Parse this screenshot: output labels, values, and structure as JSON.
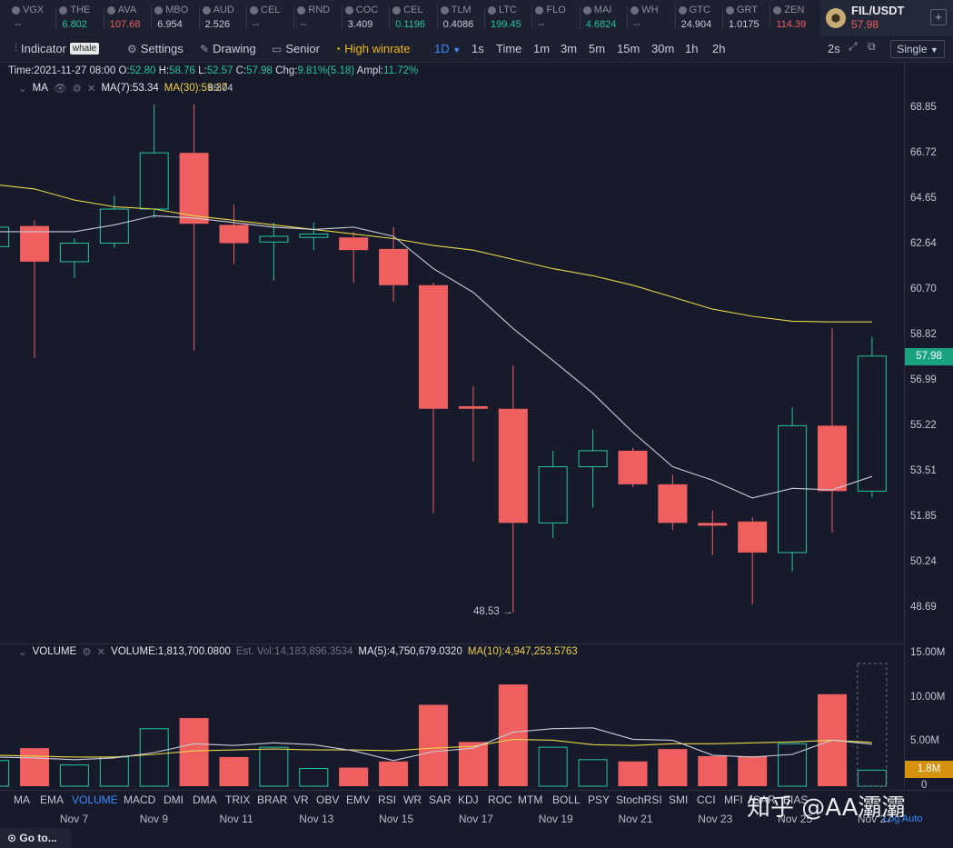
{
  "tickers": [
    {
      "name": "VGX",
      "price": "--",
      "color": "#8b90a0"
    },
    {
      "name": "THE",
      "price": "6.802",
      "color": "#23c3a0"
    },
    {
      "name": "AVA",
      "price": "107.68",
      "color": "#ef5f5f"
    },
    {
      "name": "MBO",
      "price": "6.954",
      "color": "#c9cdd7"
    },
    {
      "name": "AUD",
      "price": "2.526",
      "color": "#c9cdd7"
    },
    {
      "name": "CEL",
      "price": "--",
      "color": "#8b90a0"
    },
    {
      "name": "RND",
      "price": "--",
      "color": "#8b90a0"
    },
    {
      "name": "COC",
      "price": "3.409",
      "color": "#c9cdd7"
    },
    {
      "name": "CEL",
      "price": "0.1196",
      "color": "#23c3a0"
    },
    {
      "name": "TLM",
      "price": "0.4086",
      "color": "#c9cdd7"
    },
    {
      "name": "LTC",
      "price": "199.45",
      "color": "#23c3a0"
    },
    {
      "name": "FLO",
      "price": "--",
      "color": "#8b90a0"
    },
    {
      "name": "MAI",
      "price": "4.6824",
      "color": "#23c3a0"
    },
    {
      "name": "WH",
      "price": "--",
      "color": "#8b90a0"
    },
    {
      "name": "GTC",
      "price": "24.904",
      "color": "#c9cdd7"
    },
    {
      "name": "GRT",
      "price": "1.0175",
      "color": "#c9cdd7"
    },
    {
      "name": "ZEN",
      "price": "114.39",
      "color": "#ef5f5f"
    }
  ],
  "pair": {
    "symbol": "FIL/USDT",
    "price": "57.98",
    "add": "+"
  },
  "toolbar": {
    "indicator": "Indicator",
    "whale": "whale",
    "settings": "Settings",
    "drawing": "Drawing",
    "senior": "Senior",
    "high_winrate": "High winrate",
    "intervals": [
      "1D",
      "1s",
      "Time",
      "1m",
      "3m",
      "5m",
      "15m",
      "30m",
      "1h",
      "2h"
    ],
    "active_interval": "1D",
    "refresh": "2s",
    "mode": "Single"
  },
  "info": {
    "time_label": "Time:",
    "time": "2021-11-27 08:00",
    "o_label": "O:",
    "o": "52.80",
    "h_label": "H:",
    "h": "58.76",
    "l_label": "L:",
    "l": "52.57",
    "c_label": "C:",
    "c": "57.98",
    "chg_label": "Chg:",
    "chg": "9.81%(5.18)",
    "ampl_label": "Ampl:",
    "ampl": "11.72%"
  },
  "ma_legend": {
    "name": "MA",
    "ma7": "MA(7):53.34",
    "ma30": "MA(30):59.37"
  },
  "volume_legend": {
    "name": "VOLUME",
    "volume": "VOLUME:1,813,700.0800",
    "est": "Est. Vol:14,183,896.3534",
    "ma5": "MA(5):4,750,679.0320",
    "ma10": "MA(10):4,947,253.5763"
  },
  "price_axis": [
    "68.85",
    "66.72",
    "64.65",
    "62.64",
    "60.70",
    "58.82",
    "56.99",
    "55.22",
    "53.51",
    "51.85",
    "50.24",
    "48.69"
  ],
  "volume_axis": [
    "15.00M",
    "10.00M",
    "5.00M",
    "0"
  ],
  "last_price_tag": "57.98",
  "last_volume_tag": "1.8M",
  "low_label": "48.53 →",
  "high_label": "69.04",
  "indicators": [
    "MA",
    "EMA",
    "VOLUME",
    "MACD",
    "DMI",
    "DMA",
    "TRIX",
    "BRAR",
    "VR",
    "OBV",
    "EMV",
    "RSI",
    "WR",
    "SAR",
    "KDJ",
    "ROC",
    "MTM",
    "BOLL",
    "PSY",
    "StochRSI",
    "SMI",
    "CCI",
    "MFI",
    "SAR",
    "BIAS"
  ],
  "active_indicator": "VOLUME",
  "x_labels": [
    "Nov 7",
    "Nov 9",
    "Nov 11",
    "Nov 13",
    "Nov 15",
    "Nov 17",
    "Nov 19",
    "Nov 21",
    "Nov 23",
    "Nov 25",
    "Nov 27"
  ],
  "goto": "Go to...",
  "log_auto": "Log  Auto",
  "watermark": "知乎 @AA灞灞",
  "colors": {
    "up": "#26c6a4",
    "down": "#ef5f5f",
    "ma7": "#c8ccd8",
    "ma30": "#e8d64a",
    "bg": "#161a2b"
  },
  "chart_data": {
    "type": "candlestick",
    "x": [
      "Nov 5",
      "Nov 6",
      "Nov 7",
      "Nov 8",
      "Nov 9",
      "Nov 10",
      "Nov 11",
      "Nov 12",
      "Nov 13",
      "Nov 14",
      "Nov 15",
      "Nov 16",
      "Nov 17",
      "Nov 18",
      "Nov 19",
      "Nov 20",
      "Nov 21",
      "Nov 22",
      "Nov 23",
      "Nov 24",
      "Nov 25",
      "Nov 26",
      "Nov 27"
    ],
    "candles": [
      {
        "o": 62.55,
        "h": 63.7,
        "l": 62.4,
        "c": 63.4
      },
      {
        "o": 63.45,
        "h": 63.7,
        "l": 57.9,
        "c": 61.9
      },
      {
        "o": 61.9,
        "h": 62.9,
        "l": 61.2,
        "c": 62.7
      },
      {
        "o": 62.7,
        "h": 64.8,
        "l": 62.5,
        "c": 64.2
      },
      {
        "o": 64.2,
        "h": 69.04,
        "l": 63.8,
        "c": 66.75
      },
      {
        "o": 66.75,
        "h": 69.04,
        "l": 58.2,
        "c": 63.55
      },
      {
        "o": 63.5,
        "h": 64.4,
        "l": 61.8,
        "c": 62.7
      },
      {
        "o": 62.75,
        "h": 63.6,
        "l": 61.1,
        "c": 63.0
      },
      {
        "o": 62.95,
        "h": 63.6,
        "l": 62.4,
        "c": 63.1
      },
      {
        "o": 62.95,
        "h": 63.2,
        "l": 61.0,
        "c": 62.4
      },
      {
        "o": 62.45,
        "h": 63.4,
        "l": 60.2,
        "c": 60.9
      },
      {
        "o": 60.9,
        "h": 61.0,
        "l": 52.0,
        "c": 55.9
      },
      {
        "o": 56.0,
        "h": 56.8,
        "l": 53.9,
        "c": 55.9
      },
      {
        "o": 55.9,
        "h": 57.6,
        "l": 48.53,
        "c": 51.65
      },
      {
        "o": 51.65,
        "h": 54.3,
        "l": 51.1,
        "c": 53.7
      },
      {
        "o": 53.7,
        "h": 55.1,
        "l": 52.2,
        "c": 54.3
      },
      {
        "o": 54.3,
        "h": 54.4,
        "l": 52.95,
        "c": 53.05
      },
      {
        "o": 53.05,
        "h": 53.4,
        "l": 51.4,
        "c": 51.65
      },
      {
        "o": 51.65,
        "h": 52.1,
        "l": 50.5,
        "c": 51.55
      },
      {
        "o": 51.7,
        "h": 51.85,
        "l": 48.8,
        "c": 50.6
      },
      {
        "o": 50.6,
        "h": 55.95,
        "l": 49.95,
        "c": 55.25
      },
      {
        "o": 55.25,
        "h": 59.1,
        "l": 51.3,
        "c": 52.8
      },
      {
        "o": 52.8,
        "h": 58.76,
        "l": 52.57,
        "c": 57.98
      }
    ],
    "ma7": [
      63.2,
      63.2,
      63.2,
      63.5,
      63.9,
      63.8,
      63.6,
      63.4,
      63.3,
      63.4,
      63.0,
      61.6,
      60.6,
      59.1,
      57.8,
      56.5,
      55.0,
      53.7,
      53.2,
      52.55,
      52.9,
      52.85,
      53.34
    ],
    "ma30": [
      65.3,
      65.1,
      64.6,
      64.3,
      64.2,
      63.9,
      63.7,
      63.5,
      63.3,
      63.1,
      62.9,
      62.6,
      62.4,
      62.0,
      61.6,
      61.3,
      60.9,
      60.4,
      59.9,
      59.6,
      59.4,
      59.37,
      59.37
    ],
    "volume": [
      2.9,
      4.3,
      2.4,
      3.3,
      6.5,
      7.7,
      3.3,
      4.4,
      2.0,
      2.1,
      2.8,
      9.2,
      5.0,
      11.5,
      4.4,
      3.0,
      2.8,
      4.2,
      3.4,
      3.4,
      4.8,
      10.4,
      1.8137
    ],
    "volume_ma5": [
      3.3,
      3.2,
      3.0,
      3.2,
      3.8,
      4.8,
      4.6,
      4.9,
      4.7,
      4.0,
      2.9,
      3.9,
      4.3,
      6.1,
      6.5,
      6.6,
      5.3,
      5.2,
      3.5,
      3.3,
      3.6,
      5.2,
      4.75
    ],
    "volume_ma10": [
      3.5,
      3.4,
      3.3,
      3.3,
      3.6,
      4.0,
      4.1,
      4.2,
      4.1,
      4.1,
      4.0,
      4.3,
      4.5,
      5.3,
      5.2,
      4.7,
      4.6,
      4.8,
      4.8,
      4.9,
      5.0,
      5.2,
      4.95
    ],
    "price_ylim": [
      48.0,
      69.5
    ],
    "volume_ylim": [
      0,
      15
    ],
    "price_scale": "log"
  }
}
